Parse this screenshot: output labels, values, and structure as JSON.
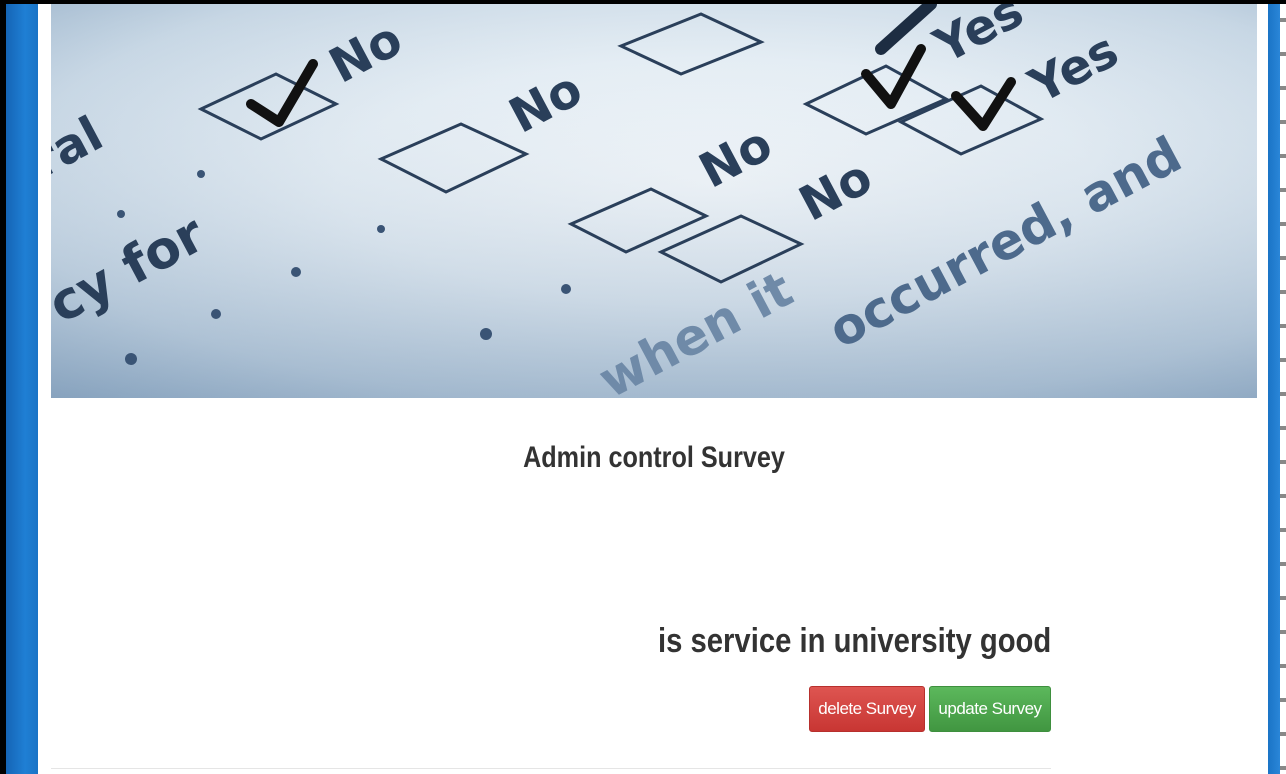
{
  "survey": {
    "heading": "Admin control Survey",
    "question": "is service in university good",
    "delete_label": "delete Survey",
    "update_label": "update Survey"
  },
  "hero_image": {
    "words": [
      "ral",
      "No",
      "No",
      "No",
      "No",
      "Yes",
      "Yes",
      "cy for",
      "occurred, and",
      "when it"
    ]
  },
  "colors": {
    "accent_blue": "#1a74c6",
    "delete_red": "#d9534f",
    "update_green": "#5cb85c",
    "text_dark": "#333333"
  }
}
